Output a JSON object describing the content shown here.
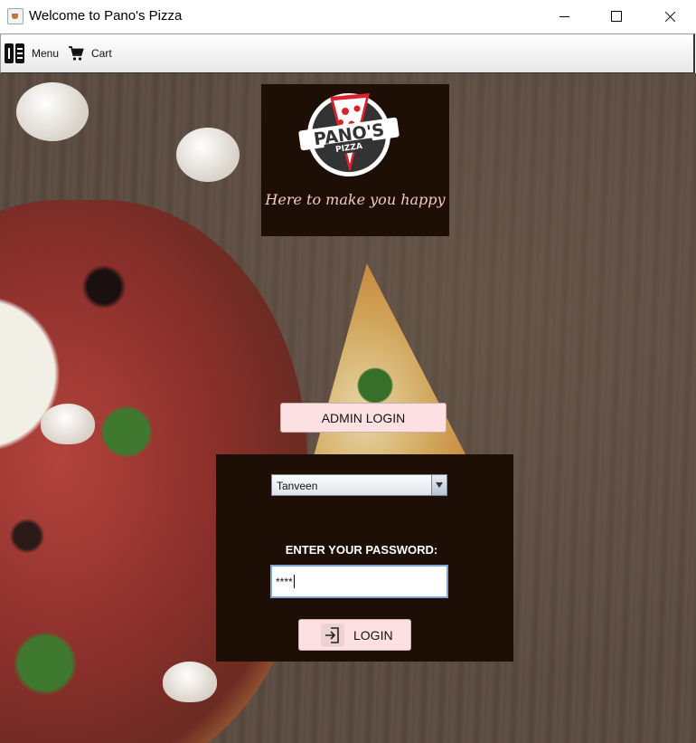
{
  "window": {
    "title": "Welcome to Pano's Pizza"
  },
  "menubar": {
    "items": [
      {
        "label": "Menu",
        "icon": "menu-book-icon"
      },
      {
        "label": "Cart",
        "icon": "shopping-cart-icon"
      }
    ]
  },
  "logo": {
    "brand_top": "PANO'S",
    "brand_bottom": "PIZZA",
    "tagline": "Here to make you happy"
  },
  "admin": {
    "button_label": "ADMIN LOGIN"
  },
  "login": {
    "user_selected": "Tanveen",
    "password_label": "ENTER YOUR PASSWORD:",
    "password_mask": "****",
    "button_label": "LOGIN",
    "button_icon": "sign-in-icon"
  },
  "colors": {
    "panel_bg": "#1e0f06",
    "button_bg": "#fde0e1",
    "logo_red": "#d8232a",
    "tagline": "#f7c9c3"
  }
}
